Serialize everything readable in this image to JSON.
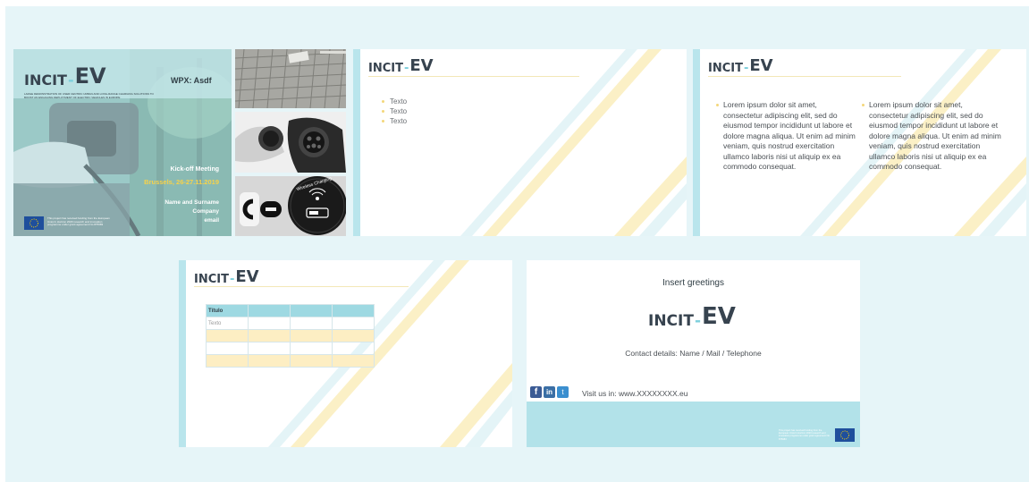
{
  "colors": {
    "canvas": "#e6f5f8",
    "accent_teal": "#b9e5ec",
    "accent_yellow": "#f8e9b0",
    "table_header": "#9ed9e2",
    "table_alt": "#fdeec3",
    "eu_blue": "#1f4f9c",
    "eu_star": "#ffd200"
  },
  "logo": {
    "incit": "INCIT",
    "dash": "-",
    "ev": "EV"
  },
  "slide1": {
    "wpx": "WPX: Asdf",
    "subtitle": "LARGE DEMONSTRATION OF USER CENTRIC URBAN AND LONG-RANGE CHARGING SOLUTIONS TO BOOST AN ENGAGING DEPLOYMENT OF ELECTRIC VEHICLES IN EUROPE",
    "meeting": "Kick-off Meeting",
    "place_date": "Brussels, 26-27.11.2019",
    "name": "Name and Surname",
    "company": "Company",
    "email": "email",
    "funding_note": "This project has received funding from the European Union's Horizon 2020 research and innovation programme under grant agreement No 875683",
    "eu_flag_icon": "eu-flag-icon"
  },
  "photos": {
    "top_icon": "ev-parking-pavement-photo",
    "mid_icon": "ev-charging-plugs-photo",
    "bottom_label": "Wireless Charging"
  },
  "slide2": {
    "bullets": [
      "Texto",
      "Texto",
      "Texto"
    ]
  },
  "slide3": {
    "col1": "Lorem ipsum dolor sit amet, consectetur adipiscing elit, sed do eiusmod tempor incididunt ut labore et dolore magna aliqua. Ut enim ad minim veniam, quis nostrud exercitation ullamco laboris nisi ut aliquip ex ea commodo consequat.",
    "col2": "Lorem ipsum dolor sit amet, consectetur adipiscing elit, sed do eiusmod tempor incididunt ut labore et dolore magna aliqua. Ut enim ad minim veniam, quis nostrud exercitation ullamco laboris nisi ut aliquip ex ea commodo consequat."
  },
  "slide4": {
    "table": {
      "header": [
        "Título",
        "",
        "",
        ""
      ],
      "rows": [
        [
          "Texto",
          "",
          "",
          ""
        ],
        [
          "",
          "",
          "",
          ""
        ],
        [
          "",
          "",
          "",
          ""
        ],
        [
          "",
          "",
          "",
          ""
        ]
      ]
    }
  },
  "slide5": {
    "greetings": "Insert greetings",
    "contact": "Contact details: Name / Mail / Telephone",
    "visit": "Visit us in: www.XXXXXXXX.eu",
    "social_icons": [
      "facebook-icon",
      "linkedin-icon",
      "twitter-icon"
    ],
    "funding_note": "This project has received funding from the European Union's Horizon 2020 research and innovation programme under grant agreement No 875683"
  }
}
